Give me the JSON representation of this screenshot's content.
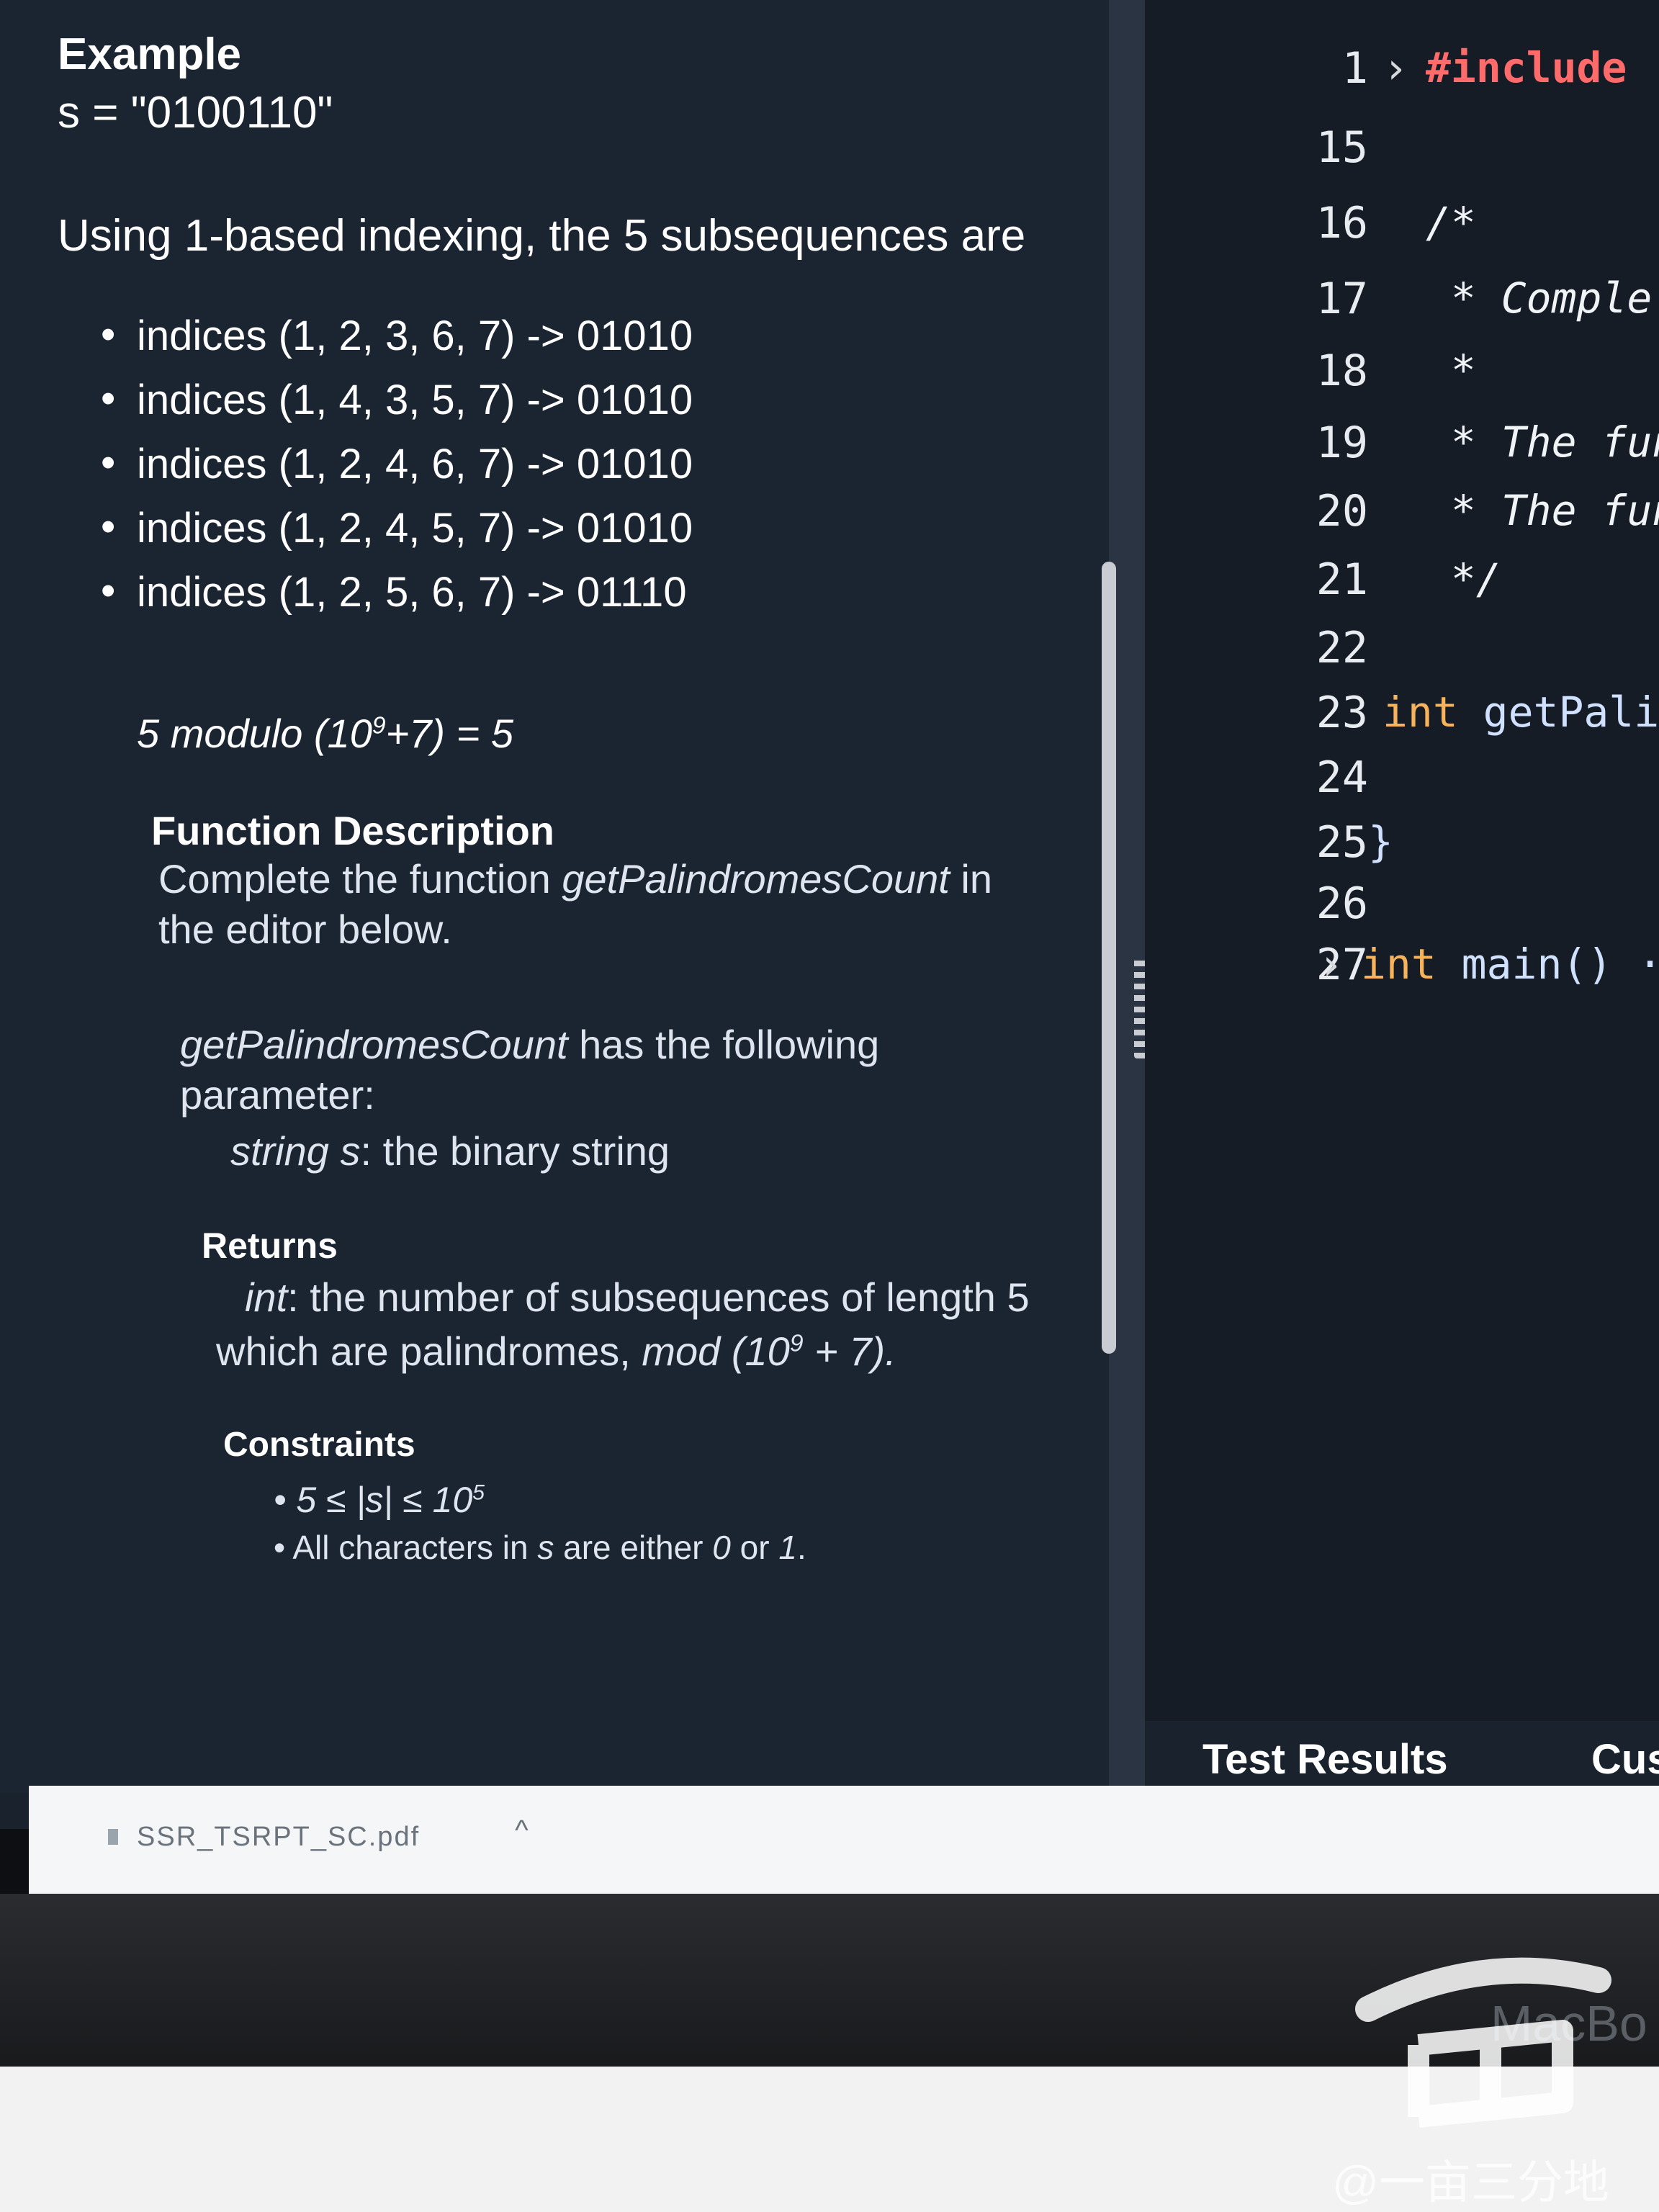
{
  "problem": {
    "example_heading": "Example",
    "example_input": "s = \"0100110\"",
    "explanation": "Using 1-based indexing, the 5 subsequences are",
    "subsequences": [
      "indices (1, 2, 3, 6, 7) -> 01010",
      "indices (1, 4, 3, 5, 7) -> 01010",
      "indices (1, 2, 4, 6, 7) -> 01010",
      "indices (1, 2, 4, 5, 7) -> 01010",
      "indices (1, 2, 5, 6, 7) -> 01110"
    ],
    "modulo_line": {
      "prefix": "5 modulo (10",
      "exp": "9",
      "suffix": "+7) = 5"
    },
    "function_description": {
      "title": "Function Description",
      "text_prefix": "Complete the function ",
      "function_name": "getPalindromesCount",
      "text_suffix": " in the editor below."
    },
    "parameters": {
      "intro_name": "getPalindromesCount",
      "intro_text": " has the following parameter:",
      "param_type": "string s",
      "param_desc": ": the binary string"
    },
    "returns": {
      "title": "Returns",
      "type": "int",
      "desc_1": ": the number of subsequences of length 5",
      "desc_2_prefix": "which are palindromes, ",
      "desc_2_mod": "mod (10",
      "desc_2_exp": "9",
      "desc_2_suffix": " + 7)."
    },
    "constraints": {
      "title": "Constraints",
      "c1_prefix": "5 ≤ |s| ≤ 10",
      "c1_exp": "5",
      "c2_prefix": "All characters in ",
      "c2_var": "s",
      "c2_mid": " are either ",
      "c2_a": "0",
      "c2_or": " or ",
      "c2_b": "1",
      "c2_end": "."
    }
  },
  "editor": {
    "lines": [
      {
        "num": "1",
        "fold": "›",
        "text": "#include",
        "kind": "inc"
      },
      {
        "num": "15",
        "fold": "",
        "text": "",
        "kind": "plain"
      },
      {
        "num": "16",
        "fold": "",
        "text": "/*",
        "kind": "cm"
      },
      {
        "num": "17",
        "fold": "",
        "text": " * Comple",
        "kind": "cm"
      },
      {
        "num": "18",
        "fold": "",
        "text": " *",
        "kind": "cm"
      },
      {
        "num": "19",
        "fold": "",
        "text": " * The fun",
        "kind": "cm"
      },
      {
        "num": "20",
        "fold": "",
        "text": " * The fun",
        "kind": "cm"
      },
      {
        "num": "21",
        "fold": "",
        "text": " */",
        "kind": "cm"
      },
      {
        "num": "22",
        "fold": "",
        "text": "",
        "kind": "plain"
      },
      {
        "num": "23",
        "fold": "",
        "text_kw": "int",
        "text": " getPali",
        "kind": "fn"
      },
      {
        "num": "24",
        "fold": "",
        "text": "",
        "kind": "plain"
      },
      {
        "num": "25",
        "fold": "",
        "text": "}",
        "kind": "plain"
      },
      {
        "num": "26",
        "fold": "",
        "text": "",
        "kind": "plain"
      },
      {
        "num": "27",
        "fold": "›",
        "text_kw": "int",
        "text": " main() ···",
        "kind": "fn"
      }
    ]
  },
  "tabs": {
    "test_results": "Test Results",
    "custom": "Cus"
  },
  "download": {
    "file_name": "SSR_TSRPT_SC.pdf"
  },
  "device": {
    "brand": "MacBo"
  },
  "watermark": {
    "text": "@一亩三分地"
  }
}
